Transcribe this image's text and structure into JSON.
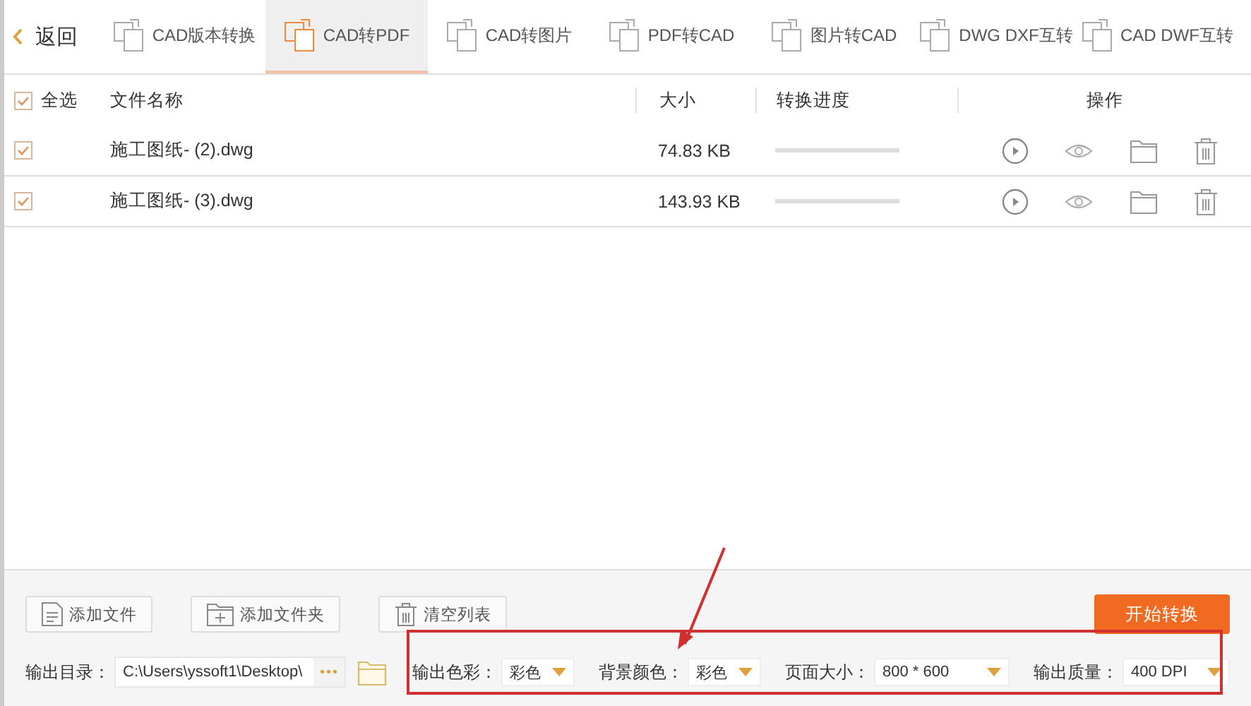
{
  "back": {
    "label": "返回"
  },
  "tabs": [
    {
      "label": "CAD版本转换",
      "selected": false
    },
    {
      "label": "CAD转PDF",
      "selected": true
    },
    {
      "label": "CAD转图片",
      "selected": false
    },
    {
      "label": "PDF转CAD",
      "selected": false
    },
    {
      "label": "图片转CAD",
      "selected": false
    },
    {
      "label": "DWG DXF互转",
      "selected": false
    },
    {
      "label": "CAD DWF互转",
      "selected": false
    }
  ],
  "table": {
    "select_all": {
      "label": "全选",
      "checked": true
    },
    "columns": [
      "文件名称",
      "大小",
      "转换进度",
      "操作"
    ],
    "rows": [
      {
        "checked": true,
        "name": "施工图纸- (2).dwg",
        "size": "74.83 KB",
        "level": 0
      },
      {
        "checked": true,
        "name": "施工图纸- (3).dwg",
        "size": "143.93 KB",
        "level": 0
      }
    ]
  },
  "buttons": [
    "添加文件",
    "添加文件夹",
    "清空列表"
  ],
  "start_button": "开始转换",
  "output_dir": {
    "label": "输出目录：",
    "value": "C:\\Users\\yssoft1\\Desktop\\",
    "browse": "•••"
  },
  "options": [
    {
      "label": "输出色彩：",
      "value": "彩色"
    },
    {
      "label": "背景颜色：",
      "value": "彩色"
    },
    {
      "label": "页面大小：",
      "value": "800 * 600"
    },
    {
      "label": "输出质量：",
      "value": "400 DPI"
    }
  ]
}
